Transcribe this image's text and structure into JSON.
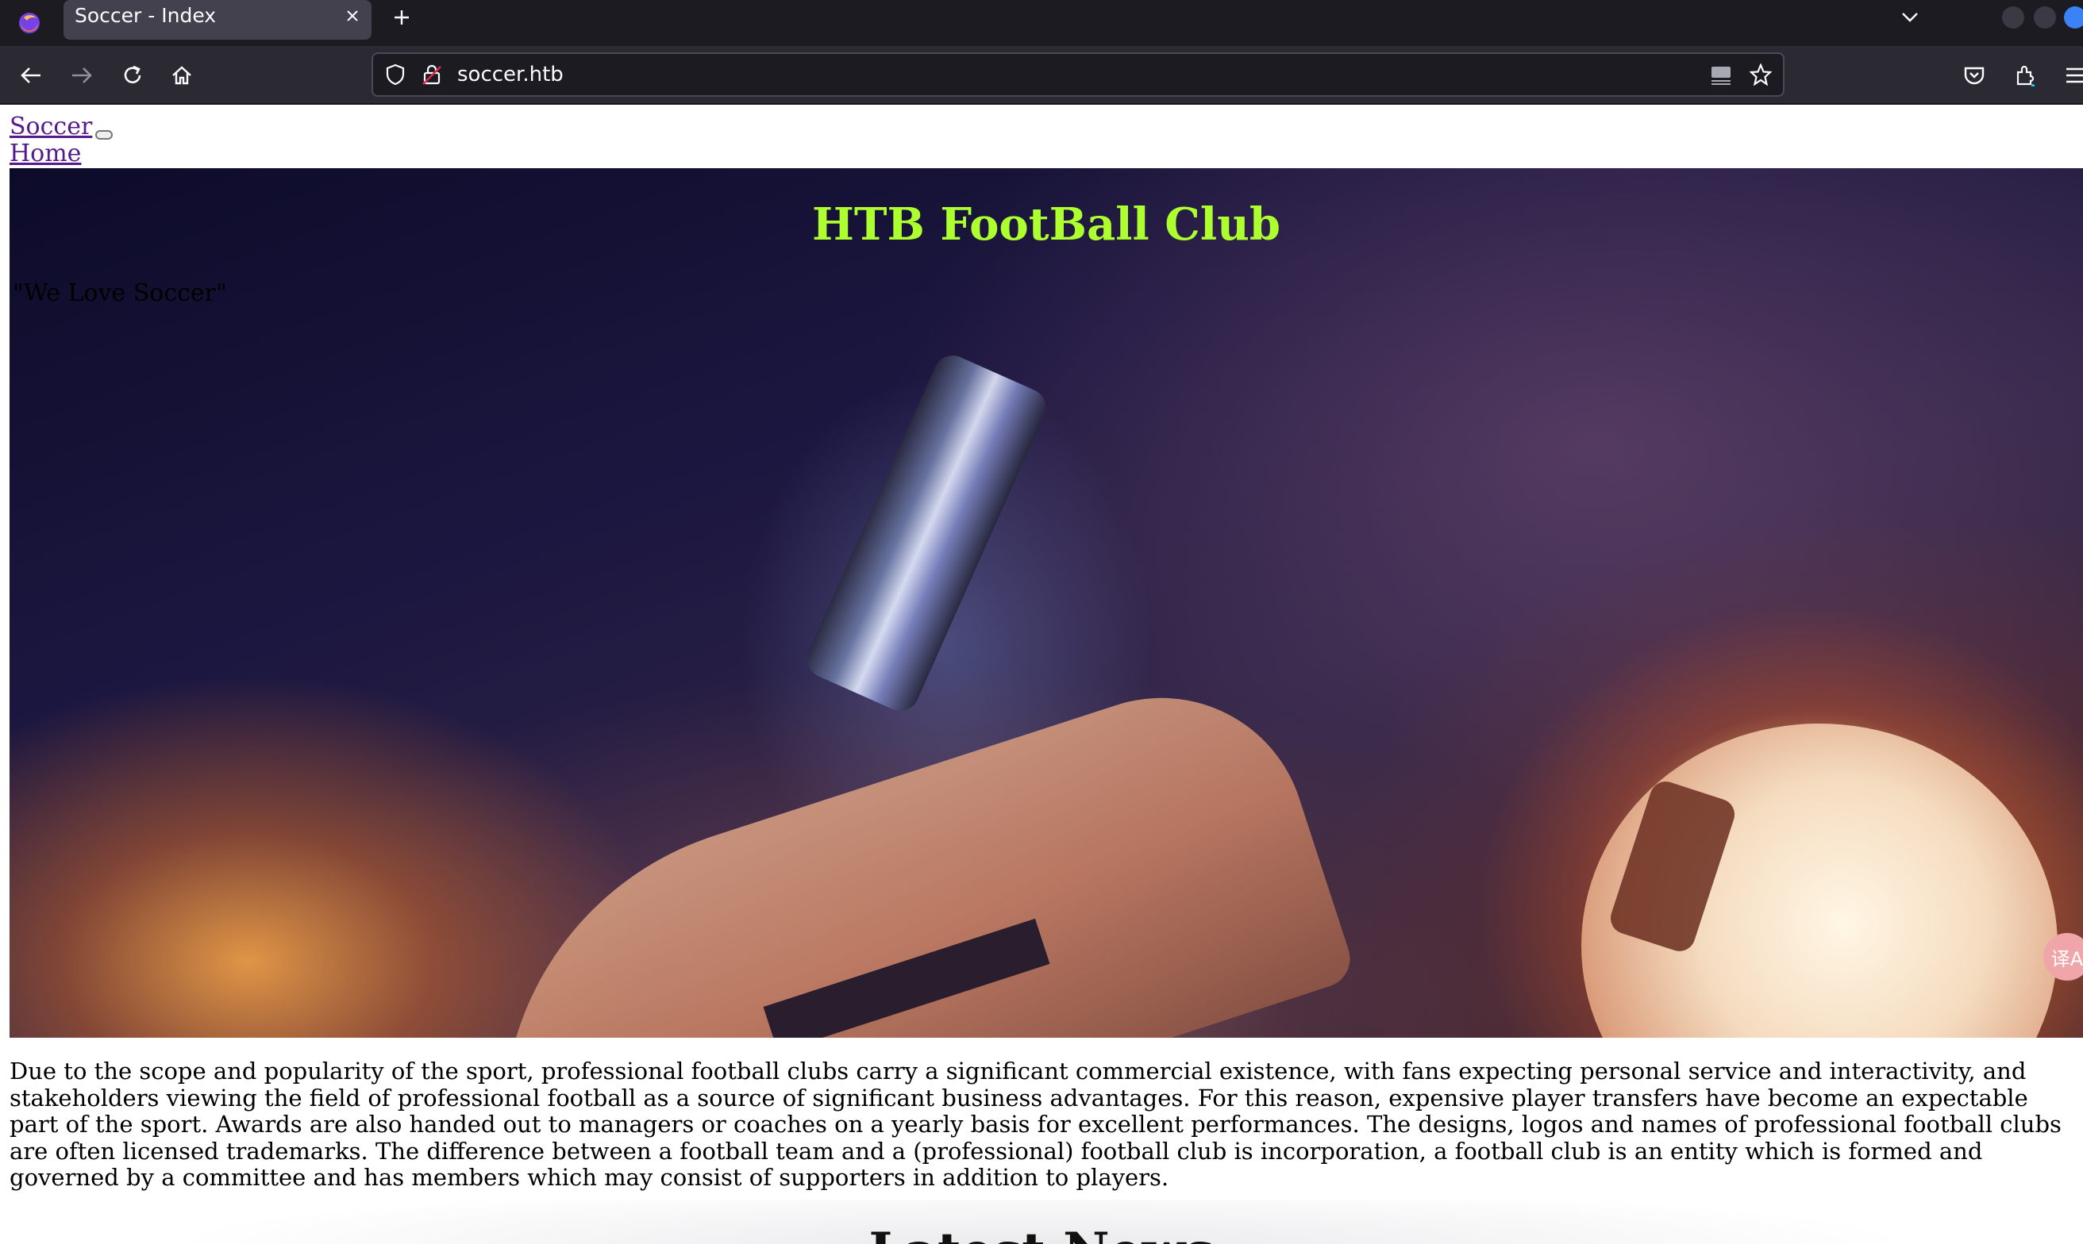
{
  "browser": {
    "tab_title": "Soccer - Index",
    "url": "soccer.htb",
    "icons": {
      "app": "firefox-logo-icon",
      "close_tab": "close-icon",
      "new_tab": "plus-icon",
      "tab_list": "chevron-down-icon",
      "back": "back-arrow-icon",
      "forward": "forward-arrow-icon",
      "reload": "reload-icon",
      "home": "home-icon",
      "tracking": "shield-icon",
      "security": "lock-insecure-icon",
      "reader": "reader-view-icon",
      "bookmark": "star-icon",
      "pocket": "pocket-icon",
      "extensions": "puzzle-icon",
      "menu": "hamburger-menu-icon"
    }
  },
  "site": {
    "brand": "Soccer",
    "nav_home": "Home",
    "hero_title": "HTB FootBall Club",
    "hero_tagline": "\"We Love Soccer\"",
    "side_badge": "译A",
    "intro": "Due to the scope and popularity of the sport, professional football clubs carry a significant commercial existence, with fans expecting personal service and interactivity, and stakeholders viewing the field of professional football as a source of significant business advantages. For this reason, expensive player transfers have become an expectable part of the sport. Awards are also handed out to managers or coaches on a yearly basis for excellent performances. The designs, logos and names of professional football clubs are often licensed trademarks. The difference between a football team and a (professional) football club is incorporation, a football club is an entity which is formed and governed by a committee and has members which may consist of supporters in addition to players.",
    "news_heading": "Latest News"
  },
  "colors": {
    "hero_title": "#adff2f",
    "link_visited": "#551a8b",
    "chrome_dark": "#1c1b22",
    "chrome_toolbar": "#2b2a33"
  }
}
